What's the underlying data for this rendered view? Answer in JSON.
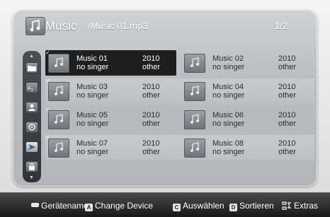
{
  "header": {
    "app_title": "Music",
    "path": "/Music 01.mp3",
    "page_indicator": "1/2",
    "app_icon": "music-folder-icon"
  },
  "sidebar": {
    "items": [
      {
        "icon": "folder-icon"
      },
      {
        "icon": "sort-az-icon"
      },
      {
        "icon": "person-icon"
      },
      {
        "icon": "genre-icon"
      },
      {
        "icon": "mood-icon",
        "active": true
      },
      {
        "icon": "lock-icon"
      }
    ]
  },
  "tracks": [
    {
      "title": "Music 01",
      "artist": "no singer",
      "year": "2010",
      "genre": "other",
      "selected": true
    },
    {
      "title": "Music 02",
      "artist": "no singer",
      "year": "2010",
      "genre": "other"
    },
    {
      "title": "Music 03",
      "artist": "no singer",
      "year": "2010",
      "genre": "other"
    },
    {
      "title": "Music 04",
      "artist": "no singer",
      "year": "2010",
      "genre": "other"
    },
    {
      "title": "Music 05",
      "artist": "no singer",
      "year": "2010",
      "genre": "other"
    },
    {
      "title": "Music 06",
      "artist": "no singer",
      "year": "2010",
      "genre": "other"
    },
    {
      "title": "Music 07",
      "artist": "no singer",
      "year": "2010",
      "genre": "other"
    },
    {
      "title": "Music 08",
      "artist": "no singer",
      "year": "2010",
      "genre": "other"
    }
  ],
  "footer": {
    "device_name": "Gerätename",
    "change_device_key": "A",
    "change_device": "Change Device",
    "select_key": "C",
    "select": "Auswählen",
    "sort_key": "D",
    "sort": "Sortieren",
    "extras": "Extras"
  },
  "colors": {
    "selected_bg": "#1f1f1f",
    "panel_bg": "#b9bdc1",
    "footer_bg": "#2c2c2c"
  }
}
